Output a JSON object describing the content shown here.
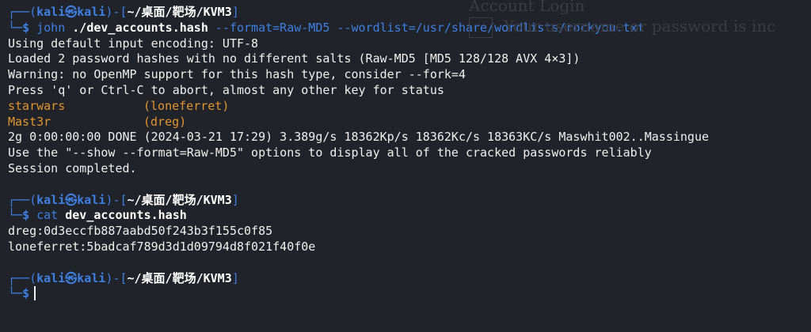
{
  "background_ghost": {
    "line1": "Account Login",
    "line2": "Your username or password is inc"
  },
  "prompt": {
    "user": "kali",
    "at_symbol": "㉿",
    "host": "kali",
    "path": "~/桌面/靶场/KVM3",
    "open": "┌──(",
    "mid": ")-[",
    "close": "]",
    "second": "└─",
    "dollar": "$"
  },
  "blocks": [
    {
      "command": "john",
      "args": [
        {
          "text": "./dev_accounts.hash",
          "style": "bold"
        },
        {
          "text": "--format=Raw-MD5",
          "style": "opt"
        },
        {
          "text": "--wordlist=/usr/share/wordlists/rockyou.txt",
          "style": "opt"
        }
      ],
      "output": [
        {
          "text": "Using default input encoding: UTF-8"
        },
        {
          "text": "Loaded 2 password hashes with no different salts (Raw-MD5 [MD5 128/128 AVX 4×3])"
        },
        {
          "text": "Warning: no OpenMP support for this hash type, consider --fork=4"
        },
        {
          "text": "Press 'q' or Ctrl-C to abort, almost any other key for status"
        },
        {
          "password": "starwars",
          "user": "(loneferret)"
        },
        {
          "password": "Mast3r",
          "user": "(dreg)"
        },
        {
          "text": "2g 0:00:00:00 DONE (2024-03-21 17:29) 3.389g/s 18362Kp/s 18362Kc/s 18363KC/s Maswhit002..Massingue"
        },
        {
          "text": "Use the \"--show --format=Raw-MD5\" options to display all of the cracked passwords reliably"
        },
        {
          "text": "Session completed."
        }
      ]
    },
    {
      "command": "cat",
      "args": [
        {
          "text": "dev_accounts.hash",
          "style": "bold"
        }
      ],
      "output": [
        {
          "text": "dreg:0d3eccfb887aabd50f243b3f155c0f85"
        },
        {
          "text": "loneferret:5badcaf789d3d1d09794d8f021f40f0e"
        }
      ]
    }
  ],
  "colors": {
    "background": "#21232b",
    "prompt_blue": "#3f7fe0",
    "found_orange": "#e09530",
    "text": "#f0f0f0"
  }
}
